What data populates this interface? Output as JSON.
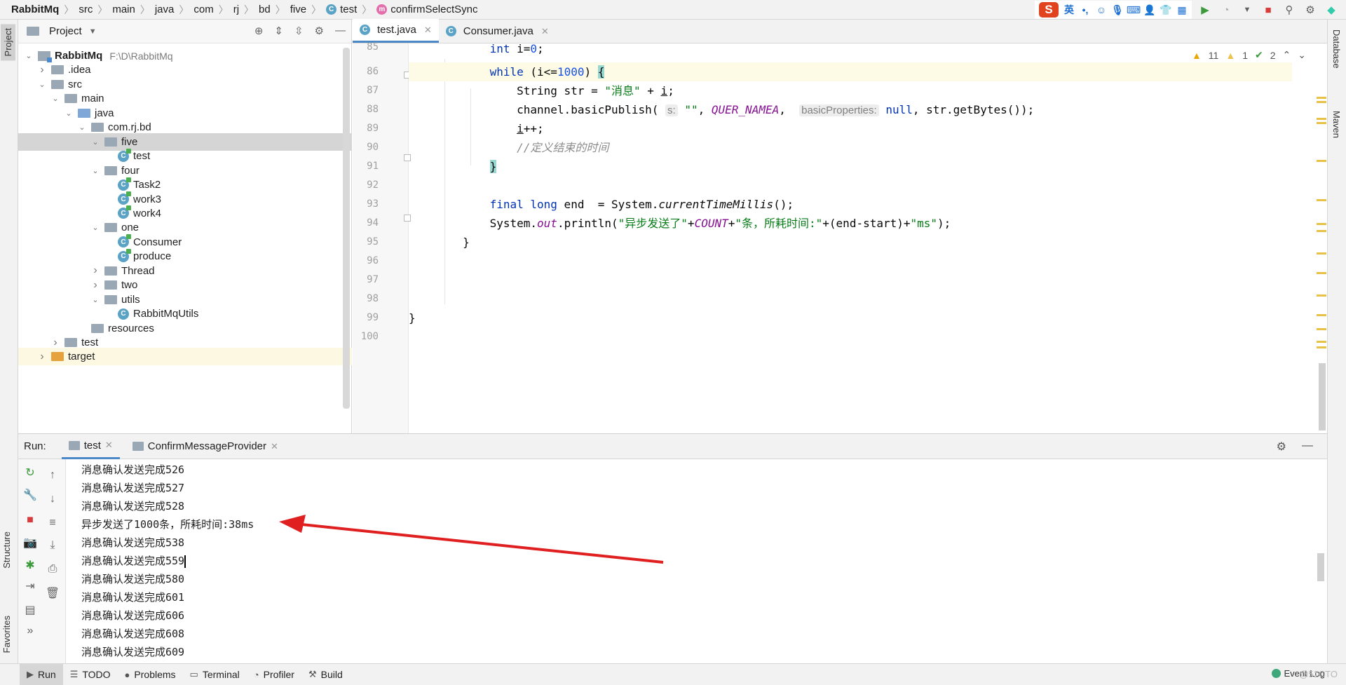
{
  "breadcrumb": {
    "root": "RabbitMq",
    "items": [
      "src",
      "main",
      "java",
      "com",
      "rj",
      "bd",
      "five"
    ],
    "class_badge": "C",
    "class_name": "test",
    "method_badge": "m",
    "method_name": "confirmSelectSync"
  },
  "ime": {
    "logo": "S",
    "lang": "英"
  },
  "left_strip": {
    "project": "Project",
    "structure": "Structure",
    "favorites": "Favorites"
  },
  "right_strip": {
    "database": "Database",
    "maven": "Maven"
  },
  "project_panel": {
    "title": "Project",
    "tree": [
      {
        "label": "RabbitMq",
        "path": "F:\\D\\RabbitMq",
        "depth": 0,
        "kind": "module",
        "open": true
      },
      {
        "label": ".idea",
        "depth": 1,
        "kind": "folder",
        "open": false
      },
      {
        "label": "src",
        "depth": 1,
        "kind": "folder",
        "open": true
      },
      {
        "label": "main",
        "depth": 2,
        "kind": "folder",
        "open": true
      },
      {
        "label": "java",
        "depth": 3,
        "kind": "src-folder",
        "open": true
      },
      {
        "label": "com.rj.bd",
        "depth": 4,
        "kind": "package",
        "open": true
      },
      {
        "label": "five",
        "depth": 5,
        "kind": "package",
        "open": true,
        "selected": true
      },
      {
        "label": "test",
        "depth": 6,
        "kind": "class-run"
      },
      {
        "label": "four",
        "depth": 5,
        "kind": "package",
        "open": true
      },
      {
        "label": "Task2",
        "depth": 6,
        "kind": "class-run"
      },
      {
        "label": "work3",
        "depth": 6,
        "kind": "class-run"
      },
      {
        "label": "work4",
        "depth": 6,
        "kind": "class-run"
      },
      {
        "label": "one",
        "depth": 5,
        "kind": "package",
        "open": true
      },
      {
        "label": "Consumer",
        "depth": 6,
        "kind": "class-run"
      },
      {
        "label": "produce",
        "depth": 6,
        "kind": "class-run"
      },
      {
        "label": "Thread",
        "depth": 5,
        "kind": "package",
        "open": false
      },
      {
        "label": "two",
        "depth": 5,
        "kind": "package",
        "open": false
      },
      {
        "label": "utils",
        "depth": 5,
        "kind": "package",
        "open": true
      },
      {
        "label": "RabbitMqUtils",
        "depth": 6,
        "kind": "class"
      },
      {
        "label": "resources",
        "depth": 4,
        "kind": "res-folder"
      },
      {
        "label": "test",
        "depth": 2,
        "kind": "folder",
        "open": false
      },
      {
        "label": "target",
        "depth": 1,
        "kind": "target-folder",
        "open": false
      }
    ]
  },
  "editor": {
    "tabs": [
      {
        "label": "test.java",
        "active": true
      },
      {
        "label": "Consumer.java",
        "active": false
      }
    ],
    "inspections": {
      "warnings": "11",
      "weak_warnings": "1",
      "ok": "2"
    },
    "line_numbers": [
      "85",
      "86",
      "87",
      "88",
      "89",
      "90",
      "91",
      "92",
      "93",
      "94",
      "95",
      "96",
      "97",
      "98",
      "99",
      "100"
    ]
  },
  "run_panel": {
    "label": "Run:",
    "tabs": [
      {
        "label": "test",
        "active": true
      },
      {
        "label": "ConfirmMessageProvider",
        "active": false
      }
    ],
    "console_lines": [
      "消息确认发送完成526",
      "消息确认发送完成527",
      "消息确认发送完成528",
      "异步发送了1000条，所耗时间:38ms",
      "消息确认发送完成538",
      "消息确认发送完成559",
      "消息确认发送完成580",
      "消息确认发送完成601",
      "消息确认发送完成606",
      "消息确认发送完成608",
      "消息确认发送完成609"
    ],
    "arrow_color": "#e02020"
  },
  "bottom_bar": {
    "tabs": [
      "Run",
      "TODO",
      "Problems",
      "Terminal",
      "Profiler",
      "Build"
    ],
    "event_log": "Event Log",
    "watermark": "@51CTO"
  },
  "colors": {
    "accent": "#4a88c7",
    "keyword": "#0033b3",
    "string": "#067d17",
    "number": "#1750eb",
    "field": "#871094"
  }
}
